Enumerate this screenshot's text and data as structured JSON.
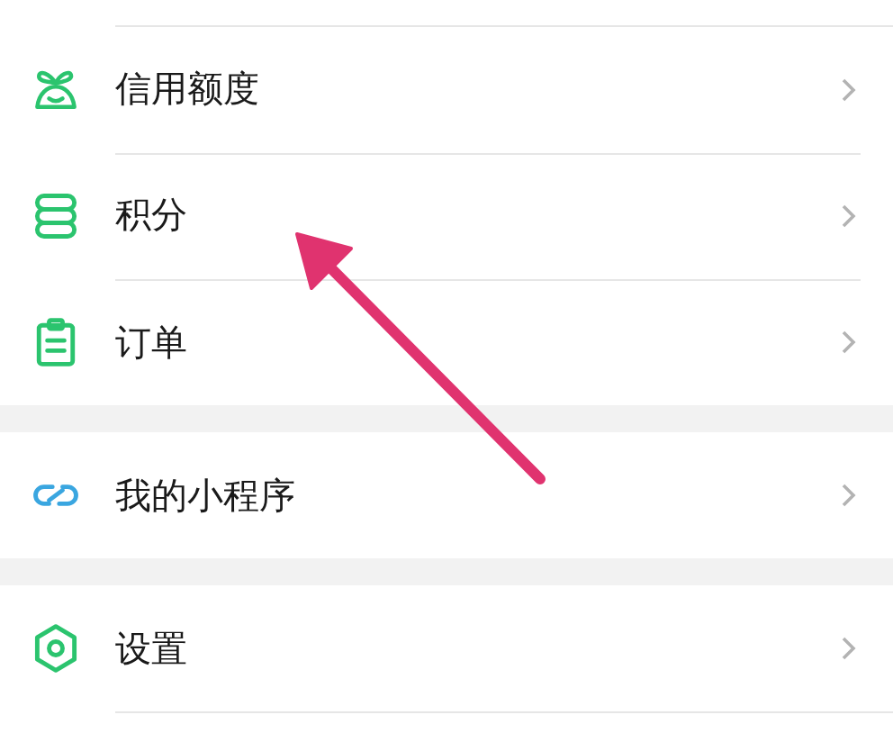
{
  "groups": [
    {
      "items": [
        {
          "kind": "credit",
          "label": "信用额度"
        },
        {
          "kind": "points",
          "label": "积分"
        },
        {
          "kind": "orders",
          "label": "订单"
        }
      ]
    },
    {
      "items": [
        {
          "kind": "miniprogram",
          "label": "我的小程序"
        }
      ]
    },
    {
      "items": [
        {
          "kind": "settings",
          "label": "设置"
        }
      ]
    }
  ]
}
